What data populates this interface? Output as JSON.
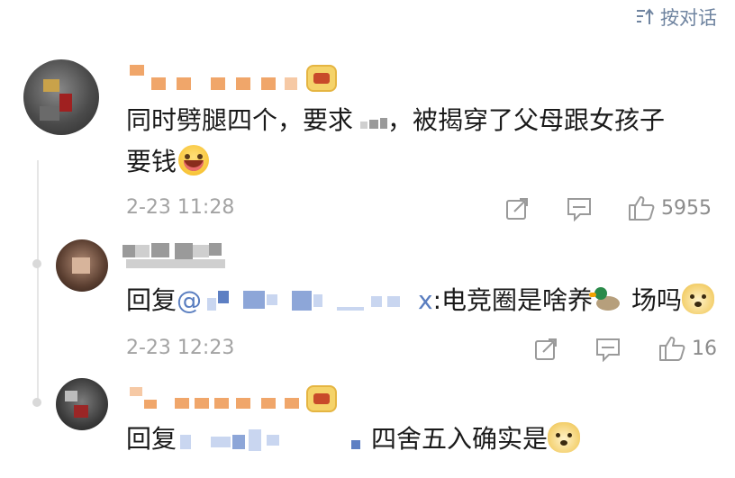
{
  "sort": {
    "label": "按对话",
    "icon": "sort-icon"
  },
  "comment": {
    "text": "同时劈腿四个，要求",
    "text_after": "，被揭穿了父母跟女孩子",
    "text_line2": "要钱",
    "emoji": "grinning-face",
    "time": "2-23 11:28",
    "likes": "5955",
    "badge_icon": "crown-badge-icon"
  },
  "replies": [
    {
      "prefix": "回复",
      "mention_at": "@",
      "mention_tail": "x",
      "text": ":电竞圈是啥养",
      "emoji1": "duck",
      "text2": "场吗",
      "emoji2": "doge",
      "time": "2-23 12:23",
      "likes": "16"
    },
    {
      "prefix": "回复",
      "text": "四舍五入确实是",
      "emoji": "doge",
      "badge_icon": "crown-badge-icon"
    }
  ],
  "colors": {
    "link": "#5a7ec0",
    "meta": "#a3a3a3",
    "sort_accent": "#6f84a0"
  }
}
